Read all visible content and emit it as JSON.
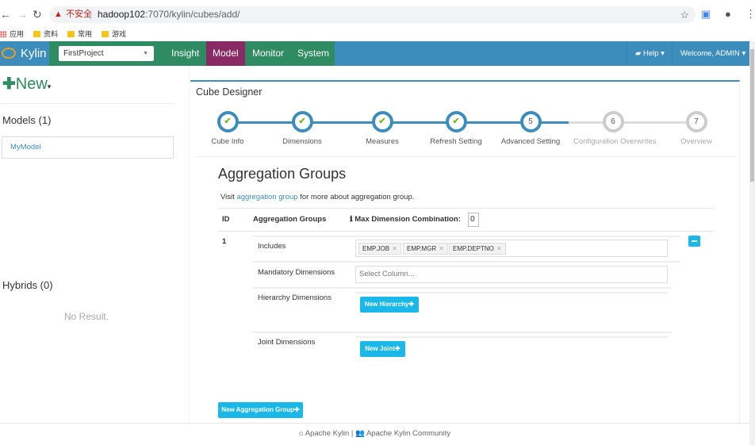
{
  "browser": {
    "back_icon": "arrow-left-icon",
    "forward_icon": "arrow-right-icon",
    "reload_icon": "reload-icon",
    "security_label": "不安全",
    "url_host": "hadoop102",
    "url_path": ":7070/kylin/cubes/add/",
    "bookmarks": [
      {
        "label": "应用",
        "icon": "apps-icon"
      },
      {
        "label": "资料",
        "icon": "folder-icon"
      },
      {
        "label": "常用",
        "icon": "folder-icon"
      },
      {
        "label": "游戏",
        "icon": "folder-icon"
      }
    ]
  },
  "navbar": {
    "brand": "Kylin",
    "project_selected": "FirstProject",
    "links": [
      {
        "label": "Insight",
        "active": false
      },
      {
        "label": "Model",
        "active": true
      },
      {
        "label": "Monitor",
        "active": false
      },
      {
        "label": "System",
        "active": false
      }
    ],
    "help_label": "Help",
    "welcome_label": "Welcome, ADMIN"
  },
  "sidebar": {
    "new_label": "New",
    "models_heading": "Models (1)",
    "models": [
      "MyModel"
    ],
    "hybrids_heading": "Hybrids (0)",
    "hybrids_empty": "No Result."
  },
  "designer": {
    "title": "Cube Designer",
    "steps": [
      {
        "label": "Cube Info",
        "num": "1",
        "state": "done"
      },
      {
        "label": "Dimensions",
        "num": "2",
        "state": "done"
      },
      {
        "label": "Measures",
        "num": "3",
        "state": "done"
      },
      {
        "label": "Refresh Setting",
        "num": "4",
        "state": "done"
      },
      {
        "label": "Advanced Setting",
        "num": "5",
        "state": "current"
      },
      {
        "label": "Configuration Overwrites",
        "num": "6",
        "state": "todo"
      },
      {
        "label": "Overview",
        "num": "7",
        "state": "todo"
      }
    ],
    "check_glyph": "✔"
  },
  "aggregation": {
    "title": "Aggregation Groups",
    "visit_prefix": "Visit ",
    "visit_link": "aggregation group",
    "visit_suffix": " for more about aggregation group.",
    "col_id": "ID",
    "col_groups": "Aggregation Groups",
    "max_dim_label": "Max Dimension Combination:",
    "max_dim_value": "0",
    "groups": [
      {
        "id": "1",
        "includes_label": "Includes",
        "includes": [
          "EMP.JOB",
          "EMP.MGR",
          "EMP.DEPTNO"
        ],
        "mandatory_label": "Mandatory Dimensions",
        "mandatory_placeholder": "Select Column...",
        "hierarchy_label": "Hierarchy Dimensions",
        "new_hierarchy": "New Hierarchy✚",
        "joint_label": "Joint Dimensions",
        "new_joint": "New Joint✚"
      }
    ],
    "new_group_button": "New Aggregation Group✚"
  },
  "footer": {
    "home_link": "Apache Kylin",
    "separator": " | ",
    "community_link": "Apache Kylin Community"
  }
}
